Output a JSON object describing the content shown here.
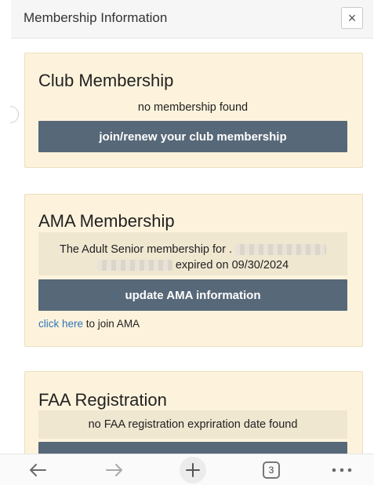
{
  "header": {
    "title": "Membership Information",
    "close_symbol": "×"
  },
  "club": {
    "title": "Club Membership",
    "status": "no membership found",
    "button_label": "join/renew your club membership"
  },
  "ama": {
    "title": "AMA Membership",
    "status_prefix": "The Adult Senior membership for .",
    "status_suffix": "expired on 09/30/2024",
    "button_label": "update AMA information",
    "link_text": "click here",
    "link_suffix": " to join AMA"
  },
  "faa": {
    "title": "FAA Registration",
    "status": "no FAA registration expriration date found"
  },
  "toolbar": {
    "tab_count": "3",
    "icons": [
      "back-arrow-icon",
      "forward-arrow-icon",
      "plus-icon",
      "tabs-icon",
      "more-icon"
    ]
  },
  "colors": {
    "card_bg": "#fdf3dc",
    "button_bg": "#576879",
    "link": "#2f76b8"
  }
}
